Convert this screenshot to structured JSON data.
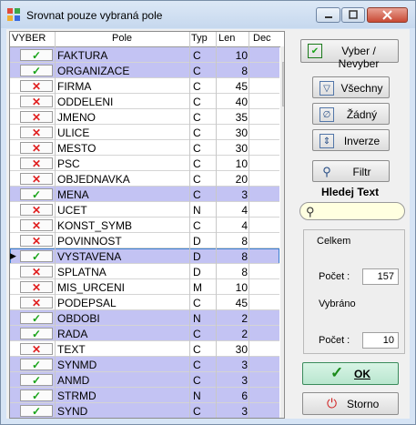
{
  "window": {
    "title": "Srovnat pouze vybraná pole"
  },
  "grid": {
    "headers": {
      "vyber": "VYBER",
      "pole": "Pole",
      "typ": "Typ",
      "len": "Len",
      "dec": "Dec"
    },
    "rows": [
      {
        "selected": true,
        "pole": "FAKTURA",
        "typ": "C",
        "len": "10"
      },
      {
        "selected": true,
        "pole": "ORGANIZACE",
        "typ": "C",
        "len": "8"
      },
      {
        "selected": false,
        "pole": "FIRMA",
        "typ": "C",
        "len": "45"
      },
      {
        "selected": false,
        "pole": "ODDELENI",
        "typ": "C",
        "len": "40"
      },
      {
        "selected": false,
        "pole": "JMENO",
        "typ": "C",
        "len": "35"
      },
      {
        "selected": false,
        "pole": "ULICE",
        "typ": "C",
        "len": "30"
      },
      {
        "selected": false,
        "pole": "MESTO",
        "typ": "C",
        "len": "30"
      },
      {
        "selected": false,
        "pole": "PSC",
        "typ": "C",
        "len": "10"
      },
      {
        "selected": false,
        "pole": "OBJEDNAVKA",
        "typ": "C",
        "len": "20"
      },
      {
        "selected": true,
        "pole": "MENA",
        "typ": "C",
        "len": "3"
      },
      {
        "selected": false,
        "pole": "UCET",
        "typ": "N",
        "len": "4"
      },
      {
        "selected": false,
        "pole": "KONST_SYMB",
        "typ": "C",
        "len": "4"
      },
      {
        "selected": false,
        "pole": "POVINNOST",
        "typ": "D",
        "len": "8"
      },
      {
        "selected": true,
        "pole": "VYSTAVENA",
        "typ": "D",
        "len": "8",
        "current": true
      },
      {
        "selected": false,
        "pole": "SPLATNA",
        "typ": "D",
        "len": "8"
      },
      {
        "selected": false,
        "pole": "MIS_URCENI",
        "typ": "M",
        "len": "10"
      },
      {
        "selected": false,
        "pole": "PODEPSAL",
        "typ": "C",
        "len": "45"
      },
      {
        "selected": true,
        "pole": "OBDOBI",
        "typ": "N",
        "len": "2"
      },
      {
        "selected": true,
        "pole": "RADA",
        "typ": "C",
        "len": "2"
      },
      {
        "selected": false,
        "pole": "TEXT",
        "typ": "C",
        "len": "30"
      },
      {
        "selected": true,
        "pole": "SYNMD",
        "typ": "C",
        "len": "3"
      },
      {
        "selected": true,
        "pole": "ANMD",
        "typ": "C",
        "len": "3"
      },
      {
        "selected": true,
        "pole": "STRMD",
        "typ": "N",
        "len": "6"
      },
      {
        "selected": true,
        "pole": "SYND",
        "typ": "C",
        "len": "3"
      }
    ]
  },
  "buttons": {
    "vyber_nevyber": "Vyber / Nevyber",
    "vsechny": "Všechny",
    "zadny": "Žádný",
    "inverze": "Inverze",
    "filtr": "Filtr",
    "ok": "OK",
    "storno": "Storno"
  },
  "search": {
    "label": "Hledej Text",
    "value": ""
  },
  "stats": {
    "celkem_label": "Celkem",
    "pocet_label": "Počet :",
    "celkem_value": "157",
    "vybrano_label": "Vybráno",
    "vybrano_value": "10"
  },
  "colors": {
    "selected_row": "#c3c3f3",
    "checked": "#1aa41a",
    "unchecked": "#e02020",
    "ok_accent": "#3a8a5b"
  }
}
